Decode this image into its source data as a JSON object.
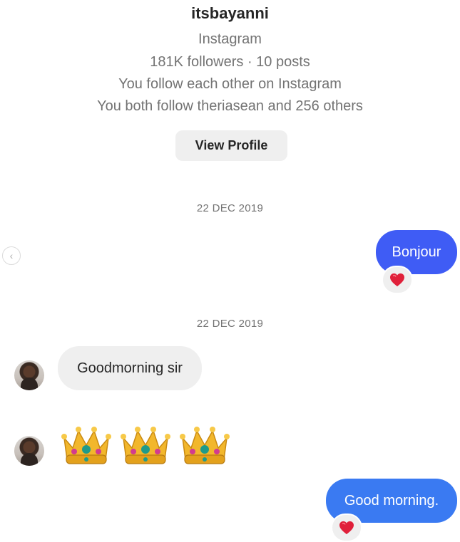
{
  "profile": {
    "username": "itsbayanni",
    "platform": "Instagram",
    "stats": "181K followers · 10 posts",
    "mutual_follow": "You follow each other on Instagram",
    "mutual_friends": "You both follow theriasean and 256 others",
    "view_profile_label": "View Profile"
  },
  "thread": {
    "date_1": "22 DEC 2019",
    "date_2": "22 DEC 2019",
    "messages": [
      {
        "direction": "sent",
        "text": "Bonjour",
        "reaction": "heart"
      },
      {
        "direction": "received",
        "text": "Goodmorning sir"
      },
      {
        "direction": "received",
        "emoji": "crown",
        "count": 3
      },
      {
        "direction": "sent",
        "text": "Good morning.",
        "reaction": "heart"
      }
    ]
  },
  "colors": {
    "sent_bubble_1": "#3f5cf5",
    "sent_bubble_2": "#3a7af2",
    "received_bubble": "#efefef",
    "secondary_text": "#737373",
    "heart": "#e0203a"
  }
}
